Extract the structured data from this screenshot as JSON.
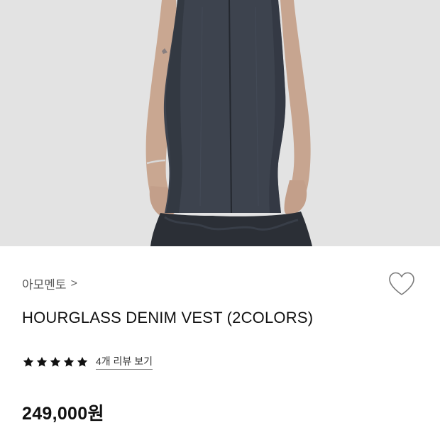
{
  "product": {
    "image_alt": "Model wearing hourglass denim vest",
    "brand": "아모멘토",
    "brand_chevron": ">",
    "name": "HOURGLASS DENIM VEST (2COLORS)",
    "rating_stars": 5,
    "review_link": "4개 리뷰 보기",
    "price": "249,000원"
  },
  "icons": {
    "wishlist": "heart-outline-icon",
    "star": "star-icon"
  },
  "colors": {
    "hero_bg": "#e4e4e4",
    "denim": "#3a3f4a",
    "text": "#111111",
    "muted": "#555555"
  }
}
